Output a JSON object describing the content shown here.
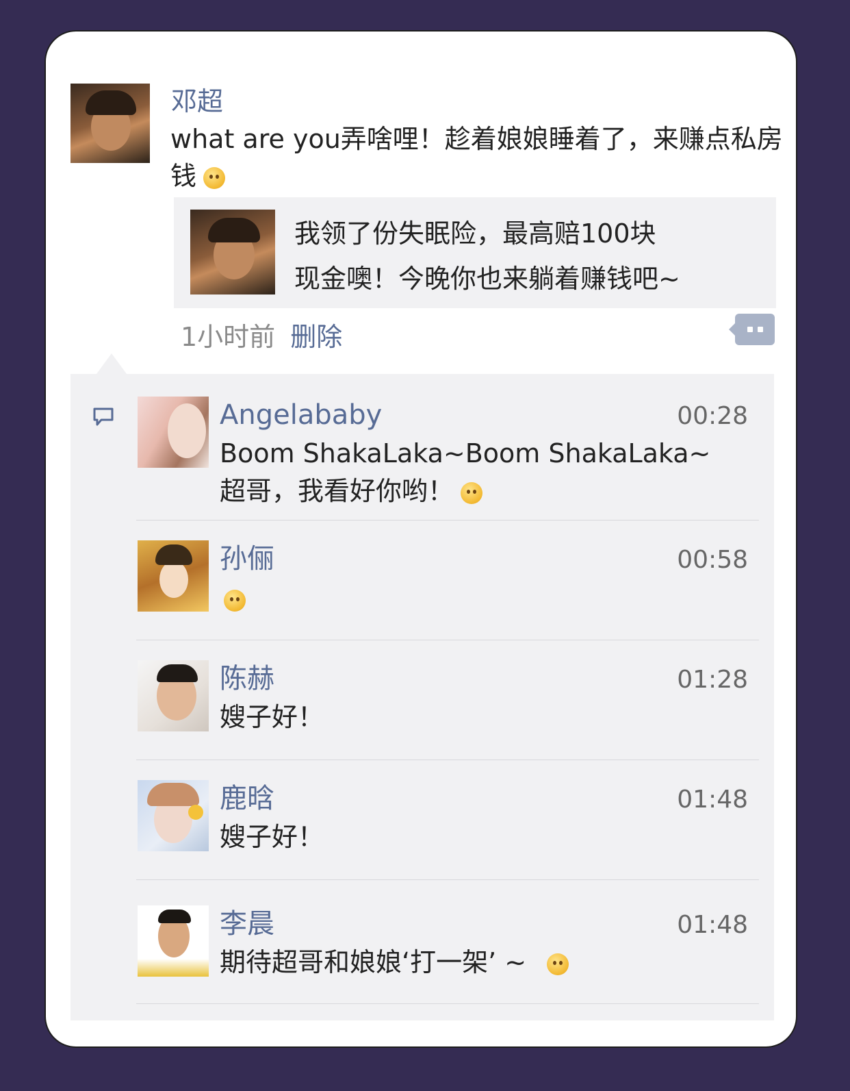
{
  "post": {
    "author": "邓超",
    "text": "what are you弄啥哩！趁着娘娘睡着了，来赚点私房钱",
    "link": {
      "line1": "我领了份失眠险，最高赔100块",
      "line2": "现金噢！今晚你也来躺着赚钱吧~"
    },
    "time": "1小时前",
    "delete_label": "删除"
  },
  "comments": [
    {
      "name": "Angelababy",
      "time": "00:28",
      "line1": "Boom ShakaLaka~Boom ShakaLaka~",
      "line2": "超哥，我看好你哟！",
      "emoji": "smile"
    },
    {
      "name": "孙俪",
      "time": "00:58",
      "line1": "",
      "line2": "",
      "emoji": "smile"
    },
    {
      "name": "陈赫",
      "time": "01:28",
      "line1": "嫂子好！",
      "line2": ""
    },
    {
      "name": "鹿晗",
      "time": "01:48",
      "line1": "嫂子好！",
      "line2": ""
    },
    {
      "name": "李晨",
      "time": "01:48",
      "line1": "期待超哥和娘娘‘打一架’ ~",
      "line2": "",
      "emoji": "grin"
    }
  ],
  "colors": {
    "background": "#352c53",
    "link_blue": "#576b95",
    "comment_bg": "#f1f1f3"
  }
}
